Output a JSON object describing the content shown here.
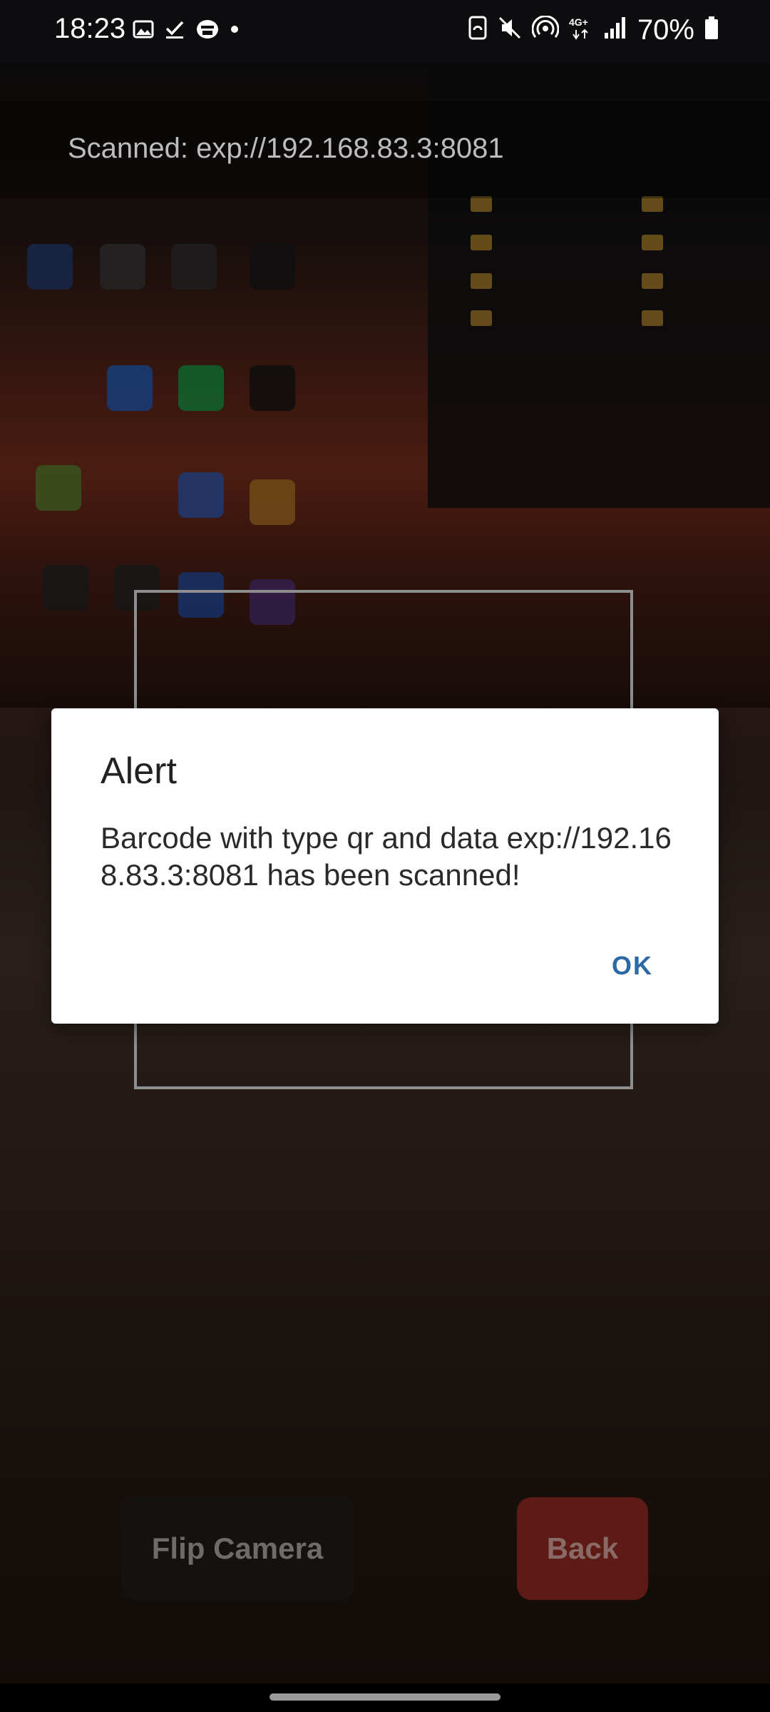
{
  "status_bar": {
    "time": "18:23",
    "left_icons": [
      "image-icon",
      "check-download-icon",
      "printer-icon",
      "dot-icon"
    ],
    "right_icons": [
      "nfc-icon",
      "mute-icon",
      "hotspot-icon",
      "4g-icon",
      "signal-icon"
    ],
    "battery_percent": "70%"
  },
  "scanner": {
    "scanned_label": "Scanned: exp://192.168.83.3:8081"
  },
  "dialog": {
    "title": "Alert",
    "message": "Barcode with type qr and data exp://192.168.83.3:8081 has been scanned!",
    "ok_label": "OK"
  },
  "controls": {
    "flip_camera_label": "Flip Camera",
    "back_label": "Back"
  },
  "colors": {
    "dialog_accent": "#2a69a6",
    "back_button": "#5e1a14"
  }
}
